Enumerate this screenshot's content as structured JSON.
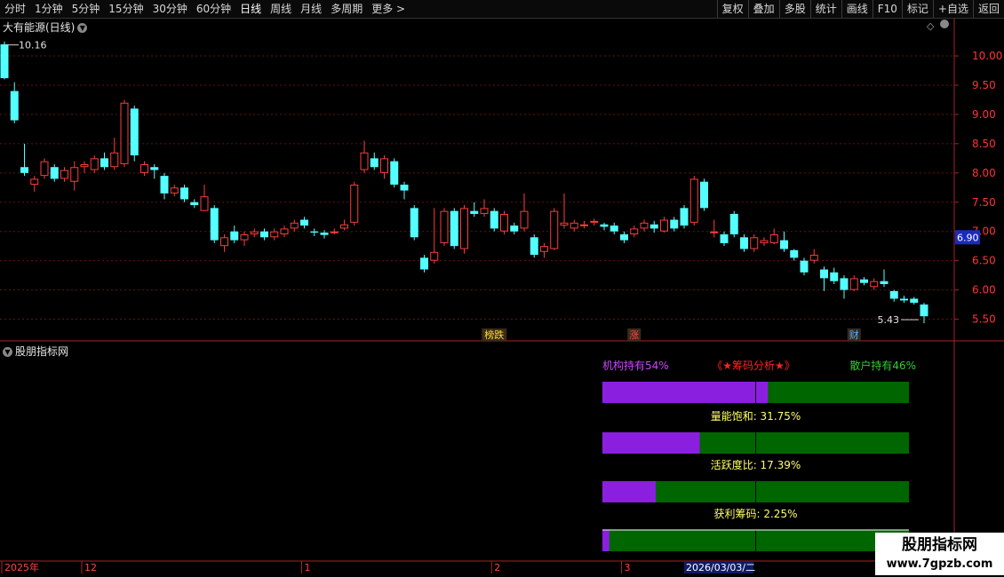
{
  "toolbar": {
    "left": [
      "分时",
      "1分钟",
      "5分钟",
      "15分钟",
      "30分钟",
      "60分钟",
      "日线",
      "周线",
      "月线",
      "多周期",
      "更多 >"
    ],
    "active": "日线",
    "right": [
      "复权",
      "叠加",
      "多股",
      "统计",
      "画线",
      "F10",
      "标记",
      "+自选",
      "返回"
    ]
  },
  "main": {
    "title": "大有能源(日线)",
    "high_label": "10.16",
    "low_label": "5.43",
    "current_price": "6.90",
    "ymin": 5.22,
    "ymax": 10.38,
    "yticks": [
      "10.00",
      "9.50",
      "9.00",
      "8.50",
      "8.00",
      "7.50",
      "7.00",
      "6.50",
      "6.00",
      "5.50"
    ],
    "markers": [
      {
        "text": "榜跌",
        "index": 49,
        "color": "#ffdd33"
      },
      {
        "text": "涨",
        "index": 63,
        "color": "#ff4444"
      },
      {
        "text": "财",
        "index": 85,
        "color": "#55aaff"
      }
    ],
    "candles": [
      [
        10.2,
        9.62,
        10.25,
        9.6
      ],
      [
        9.4,
        8.9,
        9.55,
        8.85
      ],
      [
        8.1,
        8.0,
        8.5,
        7.95
      ],
      [
        7.8,
        7.9,
        7.95,
        7.68
      ],
      [
        7.95,
        8.2,
        8.25,
        7.9
      ],
      [
        8.1,
        7.9,
        8.15,
        7.85
      ],
      [
        7.9,
        8.05,
        8.1,
        7.85
      ],
      [
        7.85,
        8.1,
        8.2,
        7.7
      ],
      [
        8.1,
        8.15,
        8.2,
        8.0
      ],
      [
        8.05,
        8.25,
        8.3,
        8.0
      ],
      [
        8.25,
        8.1,
        8.35,
        8.05
      ],
      [
        8.1,
        8.35,
        8.6,
        8.05
      ],
      [
        8.15,
        9.2,
        9.25,
        8.1
      ],
      [
        9.1,
        8.3,
        9.15,
        8.2
      ],
      [
        8.0,
        8.15,
        8.2,
        7.95
      ],
      [
        8.1,
        8.05,
        8.15,
        7.9
      ],
      [
        7.95,
        7.65,
        8.0,
        7.55
      ],
      [
        7.65,
        7.75,
        7.8,
        7.6
      ],
      [
        7.75,
        7.55,
        7.8,
        7.5
      ],
      [
        7.5,
        7.45,
        7.55,
        7.4
      ],
      [
        7.35,
        7.6,
        7.8,
        7.35
      ],
      [
        7.4,
        6.85,
        7.45,
        6.8
      ],
      [
        6.75,
        6.9,
        6.95,
        6.65
      ],
      [
        7.0,
        6.85,
        7.1,
        6.8
      ],
      [
        6.85,
        6.95,
        7.0,
        6.75
      ],
      [
        6.95,
        7.0,
        7.05,
        6.9
      ],
      [
        7.0,
        6.9,
        7.05,
        6.85
      ],
      [
        6.9,
        7.0,
        7.05,
        6.85
      ],
      [
        6.95,
        7.05,
        7.1,
        6.9
      ],
      [
        7.05,
        7.15,
        7.2,
        7.0
      ],
      [
        7.2,
        7.1,
        7.25,
        7.05
      ],
      [
        7.0,
        6.98,
        7.05,
        6.92
      ],
      [
        6.98,
        6.94,
        7.02,
        6.88
      ],
      [
        6.98,
        7.0,
        7.05,
        6.95
      ],
      [
        7.05,
        7.12,
        7.2,
        7.02
      ],
      [
        7.15,
        7.8,
        7.85,
        7.1
      ],
      [
        8.05,
        8.35,
        8.55,
        8.0
      ],
      [
        8.25,
        8.1,
        8.35,
        8.05
      ],
      [
        8.0,
        8.25,
        8.3,
        7.9
      ],
      [
        8.2,
        7.8,
        8.25,
        7.75
      ],
      [
        7.8,
        7.7,
        7.85,
        7.55
      ],
      [
        7.4,
        6.9,
        7.45,
        6.85
      ],
      [
        6.55,
        6.35,
        6.6,
        6.3
      ],
      [
        6.5,
        6.65,
        7.4,
        6.45
      ],
      [
        6.8,
        7.35,
        7.4,
        6.75
      ],
      [
        7.35,
        6.75,
        7.4,
        6.7
      ],
      [
        6.7,
        7.4,
        7.45,
        6.62
      ],
      [
        7.35,
        7.3,
        7.5,
        7.25
      ],
      [
        7.3,
        7.4,
        7.55,
        7.25
      ],
      [
        7.35,
        7.05,
        7.4,
        7.0
      ],
      [
        7.0,
        7.3,
        7.35,
        6.95
      ],
      [
        7.1,
        7.0,
        7.15,
        6.95
      ],
      [
        7.05,
        7.35,
        7.65,
        7.0
      ],
      [
        6.9,
        6.6,
        6.95,
        6.55
      ],
      [
        6.65,
        6.75,
        6.8,
        6.55
      ],
      [
        6.7,
        7.35,
        7.4,
        6.68
      ],
      [
        7.1,
        7.15,
        7.65,
        7.05
      ],
      [
        7.05,
        7.15,
        7.2,
        7.0
      ],
      [
        7.12,
        7.12,
        7.18,
        7.05
      ],
      [
        7.15,
        7.18,
        7.22,
        7.1
      ],
      [
        7.12,
        7.08,
        7.15,
        7.02
      ],
      [
        7.1,
        7.0,
        7.15,
        6.95
      ],
      [
        6.95,
        6.85,
        7.0,
        6.8
      ],
      [
        6.95,
        7.05,
        7.1,
        6.9
      ],
      [
        7.05,
        7.15,
        7.2,
        7.0
      ],
      [
        7.12,
        7.05,
        7.18,
        6.98
      ],
      [
        7.0,
        7.2,
        7.25,
        6.98
      ],
      [
        7.2,
        7.05,
        7.25,
        7.0
      ],
      [
        7.4,
        7.1,
        7.45,
        7.05
      ],
      [
        7.15,
        7.9,
        7.95,
        7.1
      ],
      [
        7.85,
        7.4,
        7.9,
        7.35
      ],
      [
        7.0,
        7.0,
        7.2,
        6.9
      ],
      [
        6.95,
        6.8,
        7.0,
        6.75
      ],
      [
        7.3,
        6.95,
        7.35,
        6.9
      ],
      [
        6.9,
        6.7,
        6.95,
        6.65
      ],
      [
        6.7,
        6.9,
        6.95,
        6.65
      ],
      [
        6.8,
        6.85,
        6.9,
        6.75
      ],
      [
        6.8,
        6.95,
        7.05,
        6.78
      ],
      [
        6.85,
        6.7,
        7.0,
        6.65
      ],
      [
        6.68,
        6.55,
        6.7,
        6.5
      ],
      [
        6.5,
        6.3,
        6.55,
        6.25
      ],
      [
        6.5,
        6.6,
        6.7,
        6.45
      ],
      [
        6.35,
        6.2,
        6.4,
        5.98
      ],
      [
        6.3,
        6.15,
        6.38,
        6.1
      ],
      [
        6.2,
        6.0,
        6.25,
        5.85
      ],
      [
        6.0,
        6.2,
        6.25,
        5.98
      ],
      [
        6.18,
        6.12,
        6.22,
        6.08
      ],
      [
        6.05,
        6.15,
        6.2,
        6.0
      ],
      [
        6.15,
        6.1,
        6.35,
        6.05
      ],
      [
        5.98,
        5.85,
        6.0,
        5.8
      ],
      [
        5.85,
        5.82,
        5.9,
        5.78
      ],
      [
        5.85,
        5.78,
        5.88,
        5.75
      ],
      [
        5.75,
        5.55,
        5.78,
        5.43
      ]
    ]
  },
  "indicator": {
    "title": "股朋指标网",
    "header_left": "机构持有54%",
    "header_center": "《★筹码分析★》",
    "header_right": "散户持有46%",
    "bars": [
      {
        "label": "",
        "fraction": 0.54
      },
      {
        "label": "量能饱和:  31.75%",
        "fraction": 0.3175
      },
      {
        "label": "活跃度比:  17.39%",
        "fraction": 0.1739
      },
      {
        "label": "获利筹码:  2.25%",
        "fraction": 0.0225
      }
    ],
    "colors": {
      "purple": "#8b1fe0",
      "green": "#006600",
      "label": "#ffff66",
      "header_left": "#cc44ff",
      "header_center": "#ff2222",
      "header_right": "#33cc33"
    }
  },
  "date_axis": {
    "labels": [
      {
        "text": "2025年",
        "index": 0
      },
      {
        "text": "12",
        "index": 8
      },
      {
        "text": "1",
        "index": 30
      },
      {
        "text": "2",
        "index": 49
      },
      {
        "text": "3",
        "index": 62
      }
    ],
    "cursor_date": "2026/03/03/二"
  },
  "watermark": {
    "brand": "股朋指标网",
    "url": "www.7gpzb.com"
  }
}
